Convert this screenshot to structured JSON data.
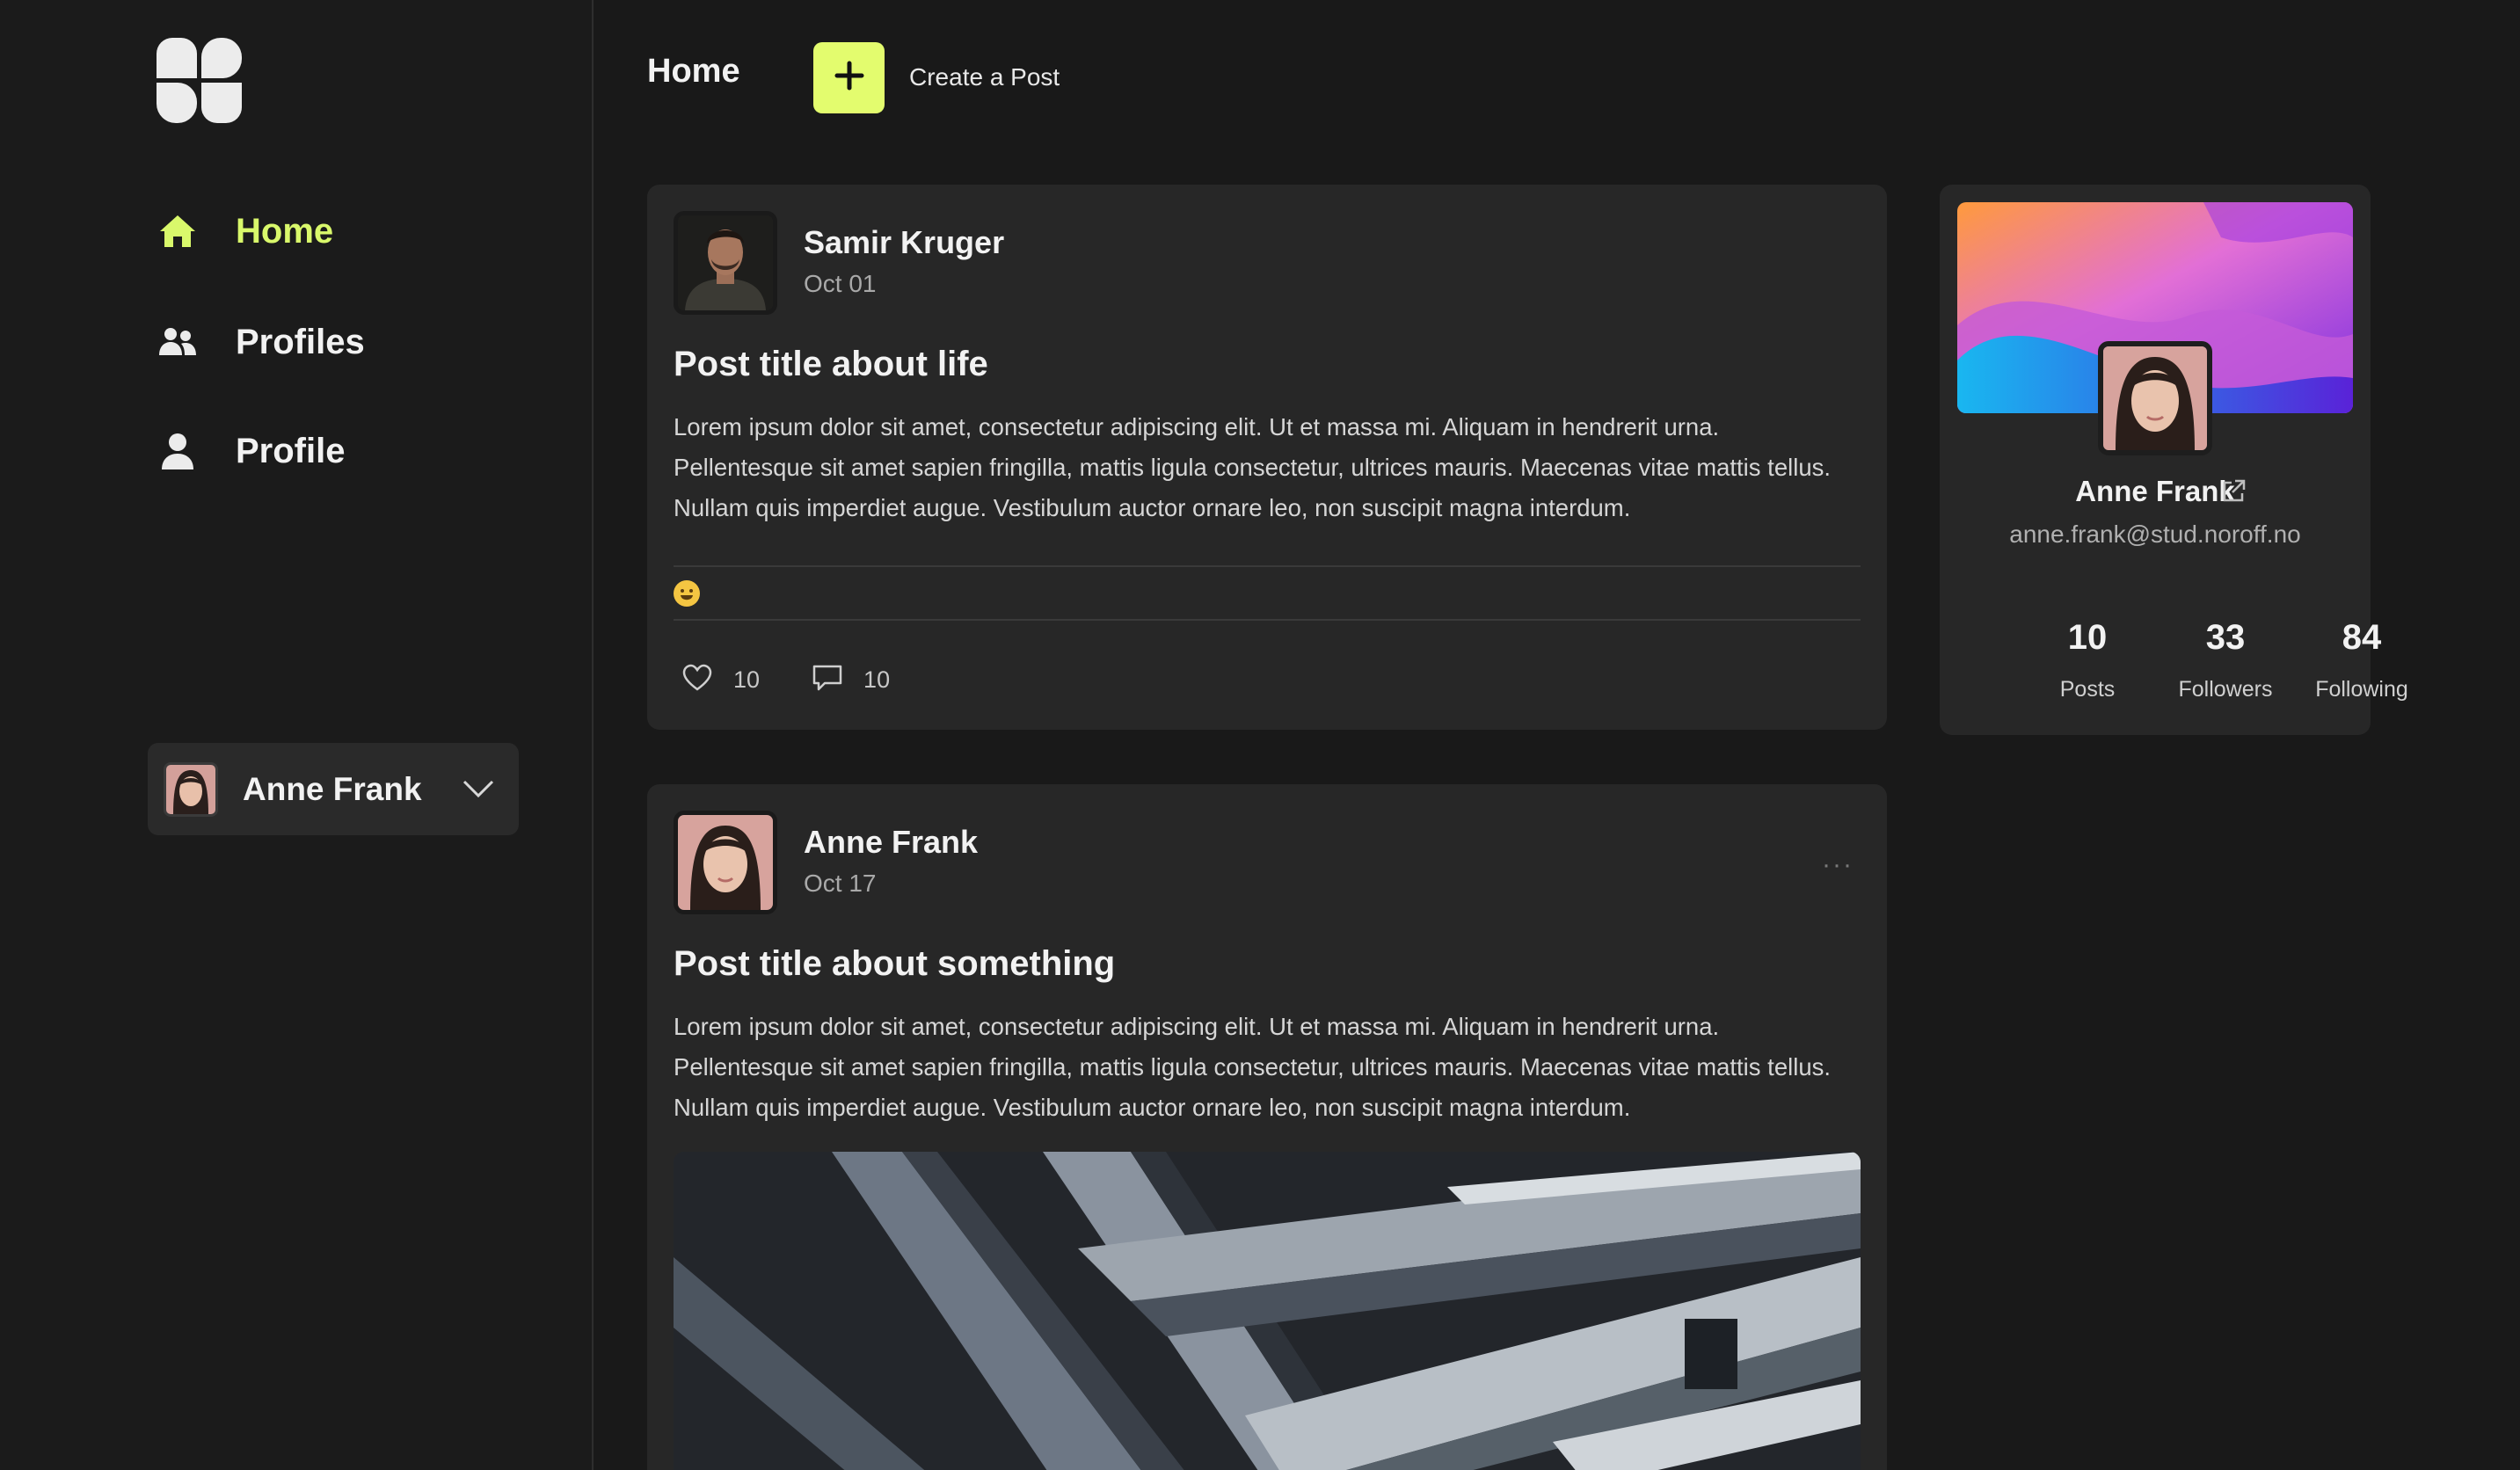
{
  "colors": {
    "accent": "#e3fc6e",
    "nav_active": "#d9f86b",
    "background": "#191919",
    "card": "#272727"
  },
  "sidebar": {
    "logo_icon": "four-petal-logo-icon",
    "items": [
      {
        "label": "Home",
        "icon": "home-icon",
        "active": true
      },
      {
        "label": "Profiles",
        "icon": "users-icon",
        "active": false
      },
      {
        "label": "Profile",
        "icon": "user-icon",
        "active": false
      }
    ],
    "current_user": {
      "name": "Anne Frank",
      "icon": "chevron-down-icon"
    }
  },
  "header": {
    "title": "Home",
    "create_label": "Create a Post",
    "create_icon": "plus-icon"
  },
  "posts": [
    {
      "author": "Samir Kruger",
      "date": "Oct 01",
      "title": "Post title about life",
      "body": "Lorem ipsum dolor sit amet, consectetur adipiscing elit. Ut et massa mi. Aliquam in hendrerit urna. Pellentesque sit amet sapien fringilla, mattis ligula consectetur, ultrices mauris. Maecenas vitae mattis tellus. Nullam quis imperdiet augue. Vestibulum auctor ornare leo, non suscipit magna interdum.",
      "reaction_icon": "smiley-emoji-icon",
      "likes": "10",
      "comments": "10"
    },
    {
      "author": "Anne Frank",
      "date": "Oct 17",
      "more": "···",
      "title": "Post title about something",
      "body": "Lorem ipsum dolor sit amet, consectetur adipiscing elit. Ut et massa mi. Aliquam in hendrerit urna. Pellentesque sit amet sapien fringilla, mattis ligula consectetur, ultrices mauris. Maecenas vitae mattis tellus. Nullam quis imperdiet augue. Vestibulum auctor ornare leo, non suscipit magna interdum."
    }
  ],
  "profile_card": {
    "name": "Anne Frank",
    "email": "anne.frank@stud.noroff.no",
    "link_icon": "external-link-icon",
    "stats": [
      {
        "value": "10",
        "label": "Posts"
      },
      {
        "value": "33",
        "label": "Followers"
      },
      {
        "value": "84",
        "label": "Following"
      }
    ]
  }
}
